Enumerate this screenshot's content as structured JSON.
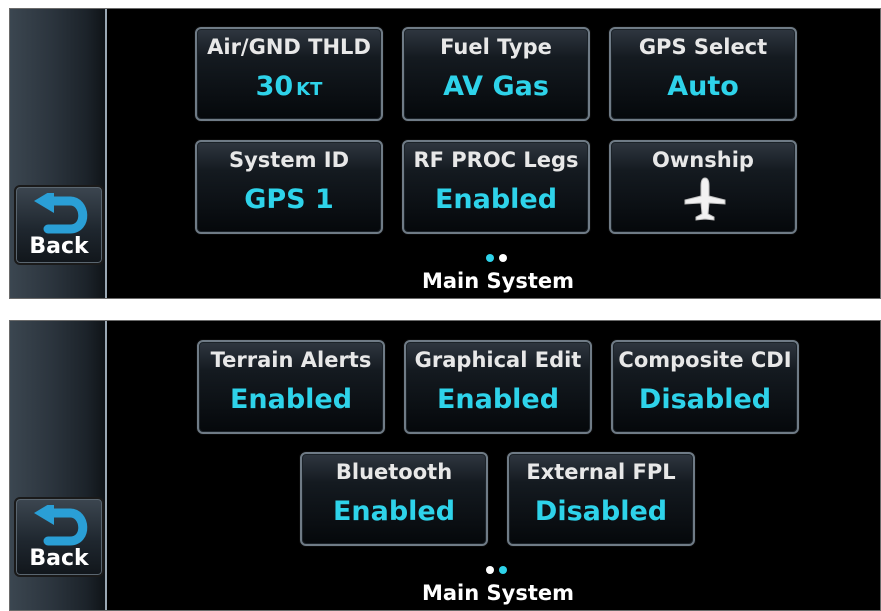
{
  "screens": [
    {
      "back_label": "Back",
      "page_title": "Main System",
      "pager": {
        "count": 2,
        "active_index": 0
      },
      "tiles": [
        {
          "label": "Air/GND THLD",
          "value": "30",
          "unit": "KT"
        },
        {
          "label": "Fuel Type",
          "value": "AV Gas"
        },
        {
          "label": "GPS Select",
          "value": "Auto"
        },
        {
          "label": "System ID",
          "value": "GPS 1"
        },
        {
          "label": "RF PROC Legs",
          "value": "Enabled"
        },
        {
          "label": "Ownship",
          "icon": "airplane-icon"
        }
      ]
    },
    {
      "back_label": "Back",
      "page_title": "Main System",
      "pager": {
        "count": 2,
        "active_index": 1
      },
      "tiles": [
        {
          "label": "Terrain Alerts",
          "value": "Enabled"
        },
        {
          "label": "Graphical Edit",
          "value": "Enabled"
        },
        {
          "label": "Composite CDI",
          "value": "Disabled"
        },
        {
          "label": "Bluetooth",
          "value": "Enabled"
        },
        {
          "label": "External FPL",
          "value": "Disabled"
        }
      ]
    }
  ],
  "colors": {
    "value_text": "#2ed3ea",
    "label_text": "#e8e8e8",
    "pager_active": "#2ed3ea",
    "pager_inactive": "#ffffff"
  }
}
